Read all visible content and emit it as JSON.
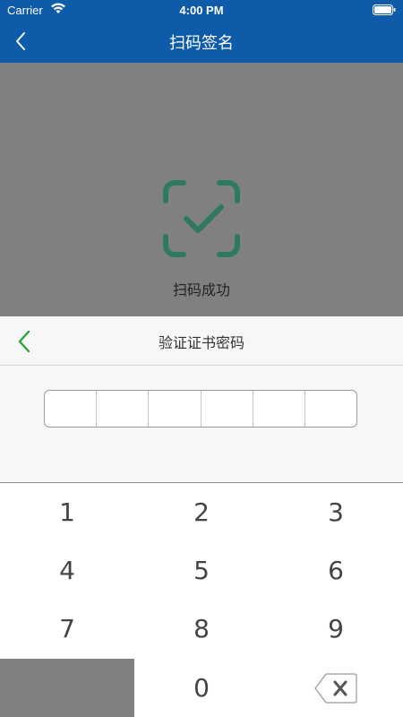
{
  "status_bar": {
    "carrier": "Carrier",
    "time": "4:00 PM",
    "icons": [
      "wifi-icon",
      "battery-icon"
    ]
  },
  "nav": {
    "title": "扫码签名",
    "back_icon": "chevron-left-icon",
    "color": "#0d5ba9"
  },
  "scan": {
    "icon": "scan-success-check-icon",
    "label": "扫码成功",
    "icon_color": "#2d7a5f"
  },
  "password_panel": {
    "title": "验证证书密码",
    "back_icon": "chevron-left-icon",
    "back_color": "#1fa22e",
    "digit_count": 6
  },
  "keypad": {
    "keys": [
      "1",
      "2",
      "3",
      "4",
      "5",
      "6",
      "7",
      "8",
      "9",
      "",
      "0",
      "delete"
    ],
    "delete_icon": "backspace-icon"
  }
}
